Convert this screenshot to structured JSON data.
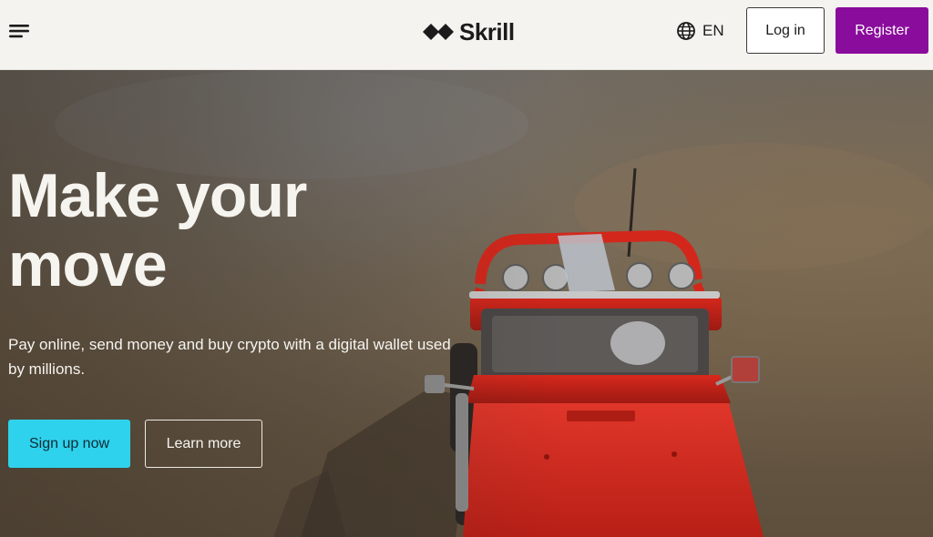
{
  "header": {
    "menu_icon": "hamburger-menu-icon",
    "brand_icon": "skrill-diamond-logo-icon",
    "brand_name": "Skrill",
    "language_icon": "globe-icon",
    "language_label": "EN",
    "login_label": "Log in",
    "register_label": "Register"
  },
  "hero": {
    "headline": "Make your move",
    "subtext": "Pay online, send money and buy crypto with a digital wallet used by millions.",
    "primary_cta": "Sign up now",
    "secondary_cta": "Learn more",
    "image_subject": "red-off-road-jeep-on-sand"
  },
  "colors": {
    "header_bg": "#f4f3ef",
    "register_bg": "#8a0c9c",
    "signup_bg": "#2fd2ec",
    "text_light": "#f6f4ef",
    "text_dark": "#1b1b1b",
    "jeep_red": "#d9261c"
  }
}
